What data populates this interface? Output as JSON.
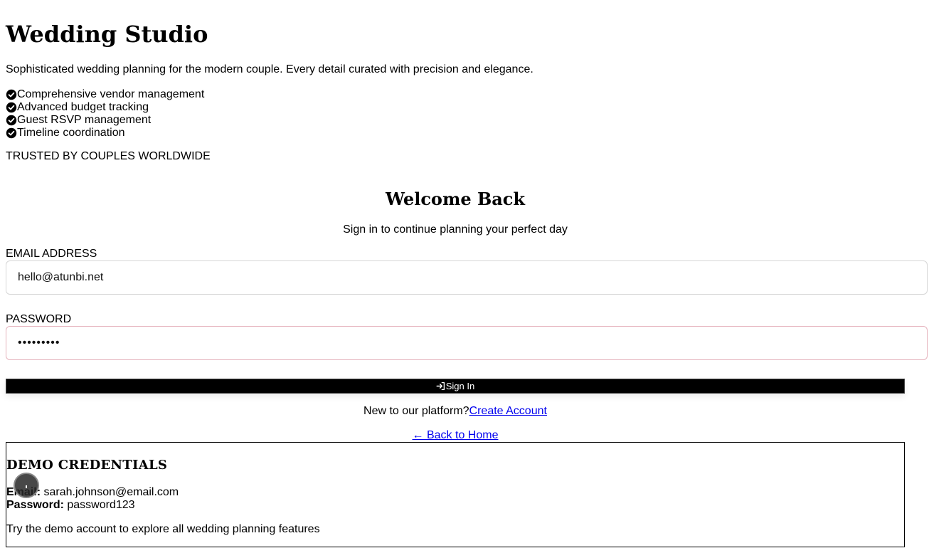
{
  "brand": {
    "title": "Wedding Studio",
    "tagline": "Sophisticated wedding planning for the modern couple. Every detail curated with precision and elegance.",
    "features": [
      "Comprehensive vendor management",
      "Advanced budget tracking",
      "Guest RSVP management",
      "Timeline coordination"
    ],
    "trusted": "TRUSTED BY COUPLES WORLDWIDE"
  },
  "login": {
    "heading": "Welcome Back",
    "subtitle": "Sign in to continue planning your perfect day",
    "email_label": "EMAIL ADDRESS",
    "email_value": "hello@atunbi.net",
    "password_label": "PASSWORD",
    "password_value": "password1",
    "signin_label": "Sign In",
    "new_prompt": "New to our platform?",
    "create_account": "Create Account",
    "back_home": "← Back to Home"
  },
  "demo": {
    "heading": "DEMO CREDENTIALS",
    "email_key": "Email:",
    "email_value": "sarah.johnson@email.com",
    "password_key": "Password:",
    "password_value": "password123",
    "note": "Try the demo account to explore all wedding planning features"
  },
  "icons": {
    "feature_check": "check-circle-icon",
    "signin": "sign-in-icon"
  },
  "colors": {
    "button_bg": "#000000",
    "link": "#0000ee",
    "password_border": "#e5b3bd"
  }
}
